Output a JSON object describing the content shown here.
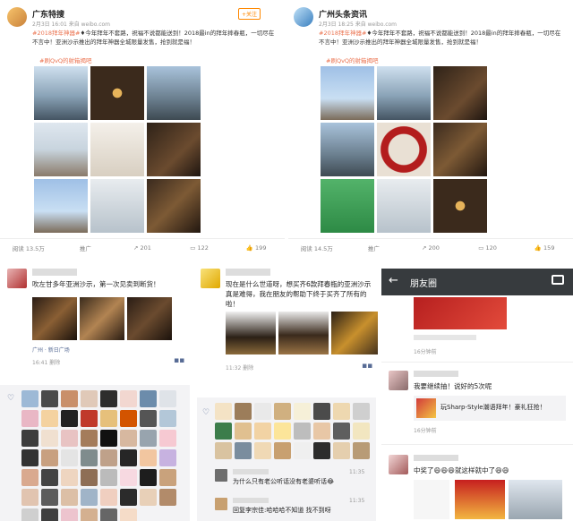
{
  "post1": {
    "username": "广东特搜",
    "meta": "2月3日 16:01 来自 weibo.com",
    "follow_label": "+关注",
    "text_tag": "#2018拜年神器#",
    "text": "♦今年拜年不套路，祝福不说都能送到！2018最in的拜年摔春瓶，一切尽在不言中！亚洲沙示推出的拜年神器全城限量发售，抢到就是福！",
    "link": "#刷QvQ的射箱揭吧",
    "actions": {
      "read": "阅读 13.5万",
      "promote": "推广",
      "repost": "201",
      "comment": "122",
      "like": "199"
    }
  },
  "post2": {
    "username": "广州头条资讯",
    "meta": "2月3日 18:25 来自 weibo.com",
    "text_tag": "#2018拜年神器#",
    "text": "♦今年拜年不套路，祝福不说都能送到！2018最in的拜年摔春瓶，一切尽在不言中！亚洲沙示推出的拜年神器全城限量发售，抢到就是福！",
    "link": "#刷QvQ的射箱揭吧",
    "actions": {
      "read": "阅读 14.5万",
      "promote": "推广",
      "repost": "200",
      "comment": "120",
      "like": "159"
    }
  },
  "moment1": {
    "text": "吹左甘多年亚洲沙示，第一次见卖到断货！",
    "location": "广州 · 新日广场",
    "time": "16:41 删除"
  },
  "moment2": {
    "text": "现在是什么世道呀，想买齐6款拜春瓶的亚洲沙示真是难得，我在朋友的帮助下终于买齐了所有的啦！",
    "time": "11:32 删除"
  },
  "wechat": {
    "title": "朋友圈",
    "back_icon": "back-arrow-icon",
    "camera_icon": "camera-icon",
    "post_a_time": "16分钟前",
    "post_b_text": "我要继续抽！说好的5次呢",
    "post_b_card": "玩Sharp-Style潮语拜年！豪礼狂抢！",
    "post_b_time": "16分钟前",
    "post_c_text": "中奖了😄😄😄就这样就中了😄😄"
  },
  "comments": {
    "time1": "11:35",
    "c1": "为什么只有老公听话没有老婆听话😂",
    "time2": "11:35",
    "c2": "回复李宗佳:哈哈哈不知道 找不到呀"
  }
}
